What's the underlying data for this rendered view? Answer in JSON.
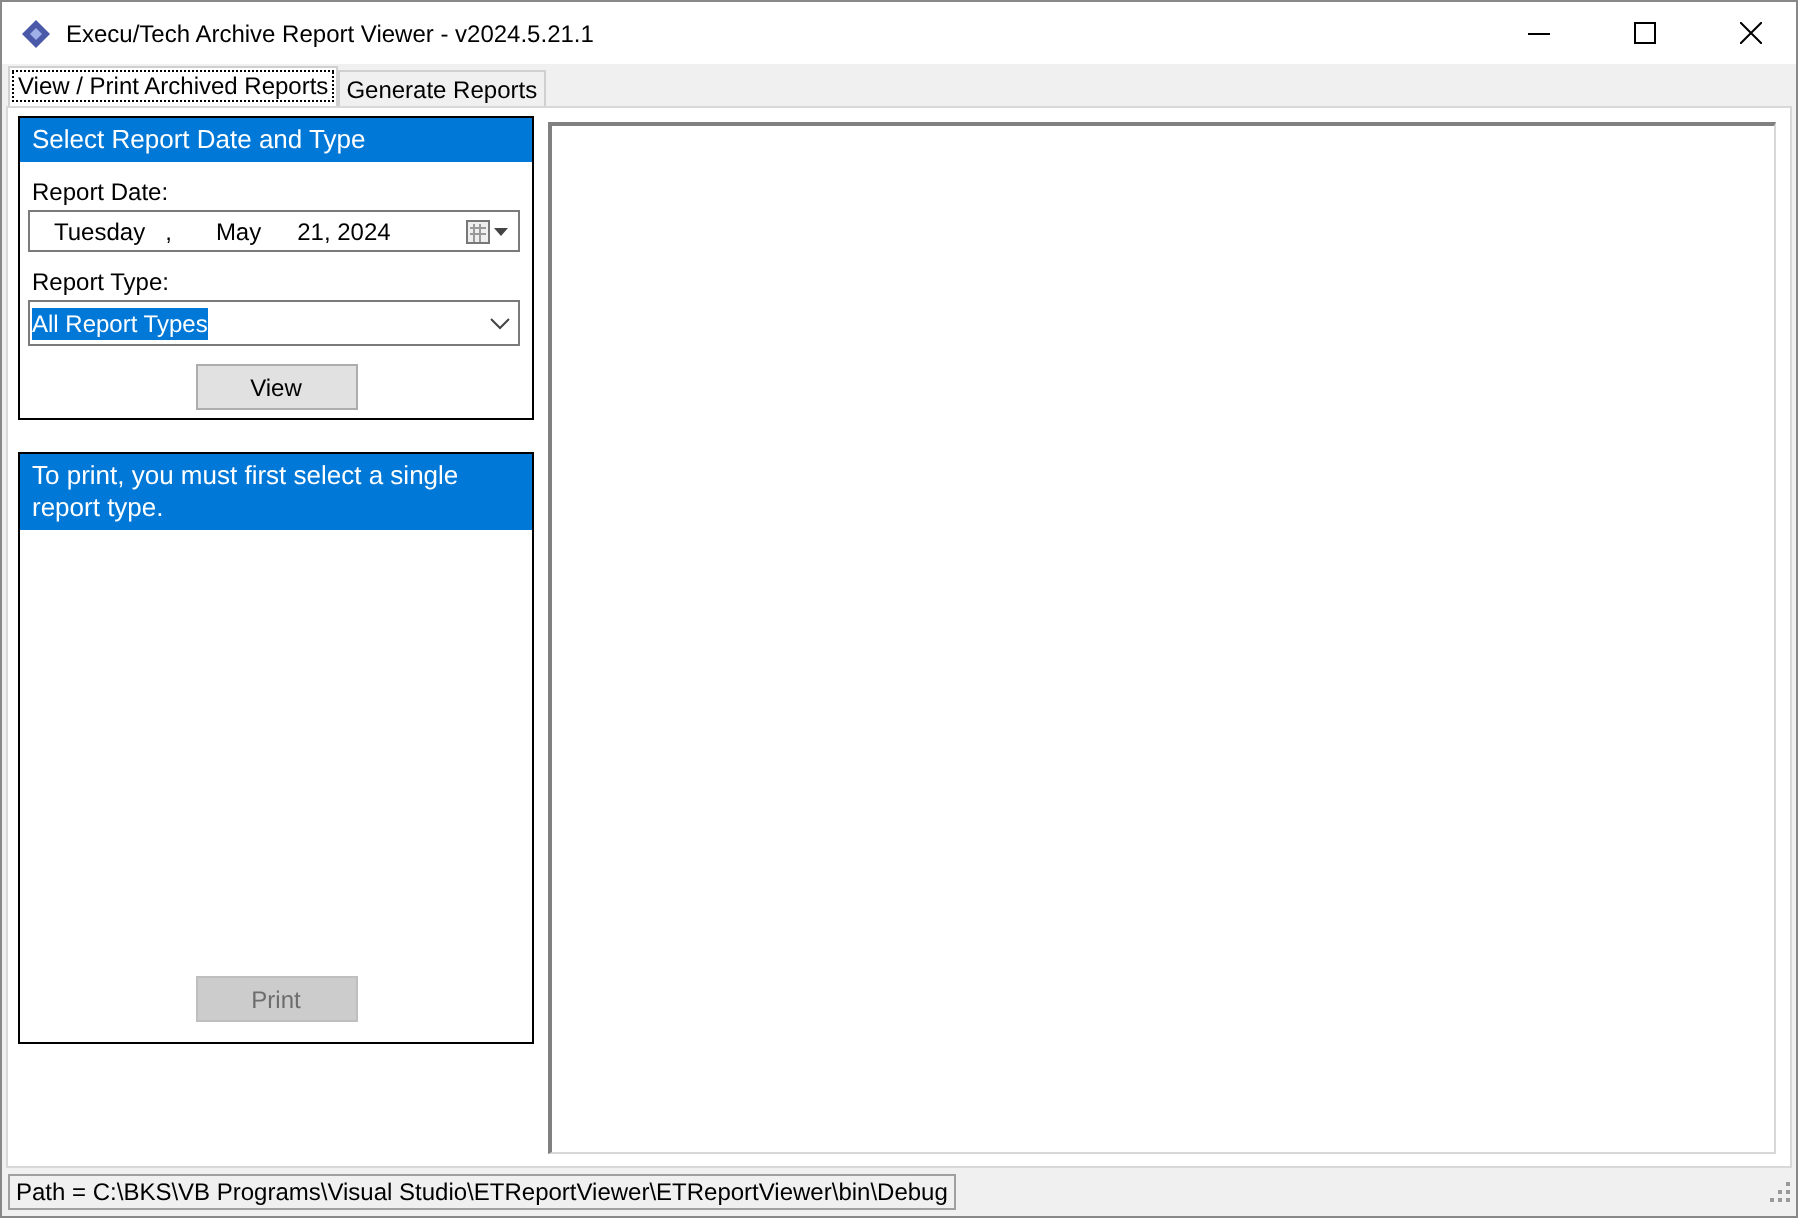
{
  "window": {
    "title": "Execu/Tech Archive Report Viewer - v2024.5.21.1"
  },
  "tabs": [
    {
      "label": "View / Print Archived Reports",
      "selected": true
    },
    {
      "label": "Generate Reports",
      "selected": false
    }
  ],
  "select_panel": {
    "header": "Select Report Date and Type",
    "date_label": "Report Date:",
    "date_parts": [
      "Tuesday",
      ",",
      "May",
      "21, 2024"
    ],
    "type_label": "Report Type:",
    "type_value": "All Report Types",
    "type_selected": true,
    "button": {
      "label": "View",
      "disabled": false
    }
  },
  "print_panel": {
    "header": "To print, you must first select a single report type.",
    "button": {
      "label": "Print",
      "disabled": true
    }
  },
  "status_bar": {
    "path": "Path = C:\\BKS\\VB Programs\\Visual Studio\\ETReportViewer\\ETReportViewer\\bin\\Debug"
  }
}
